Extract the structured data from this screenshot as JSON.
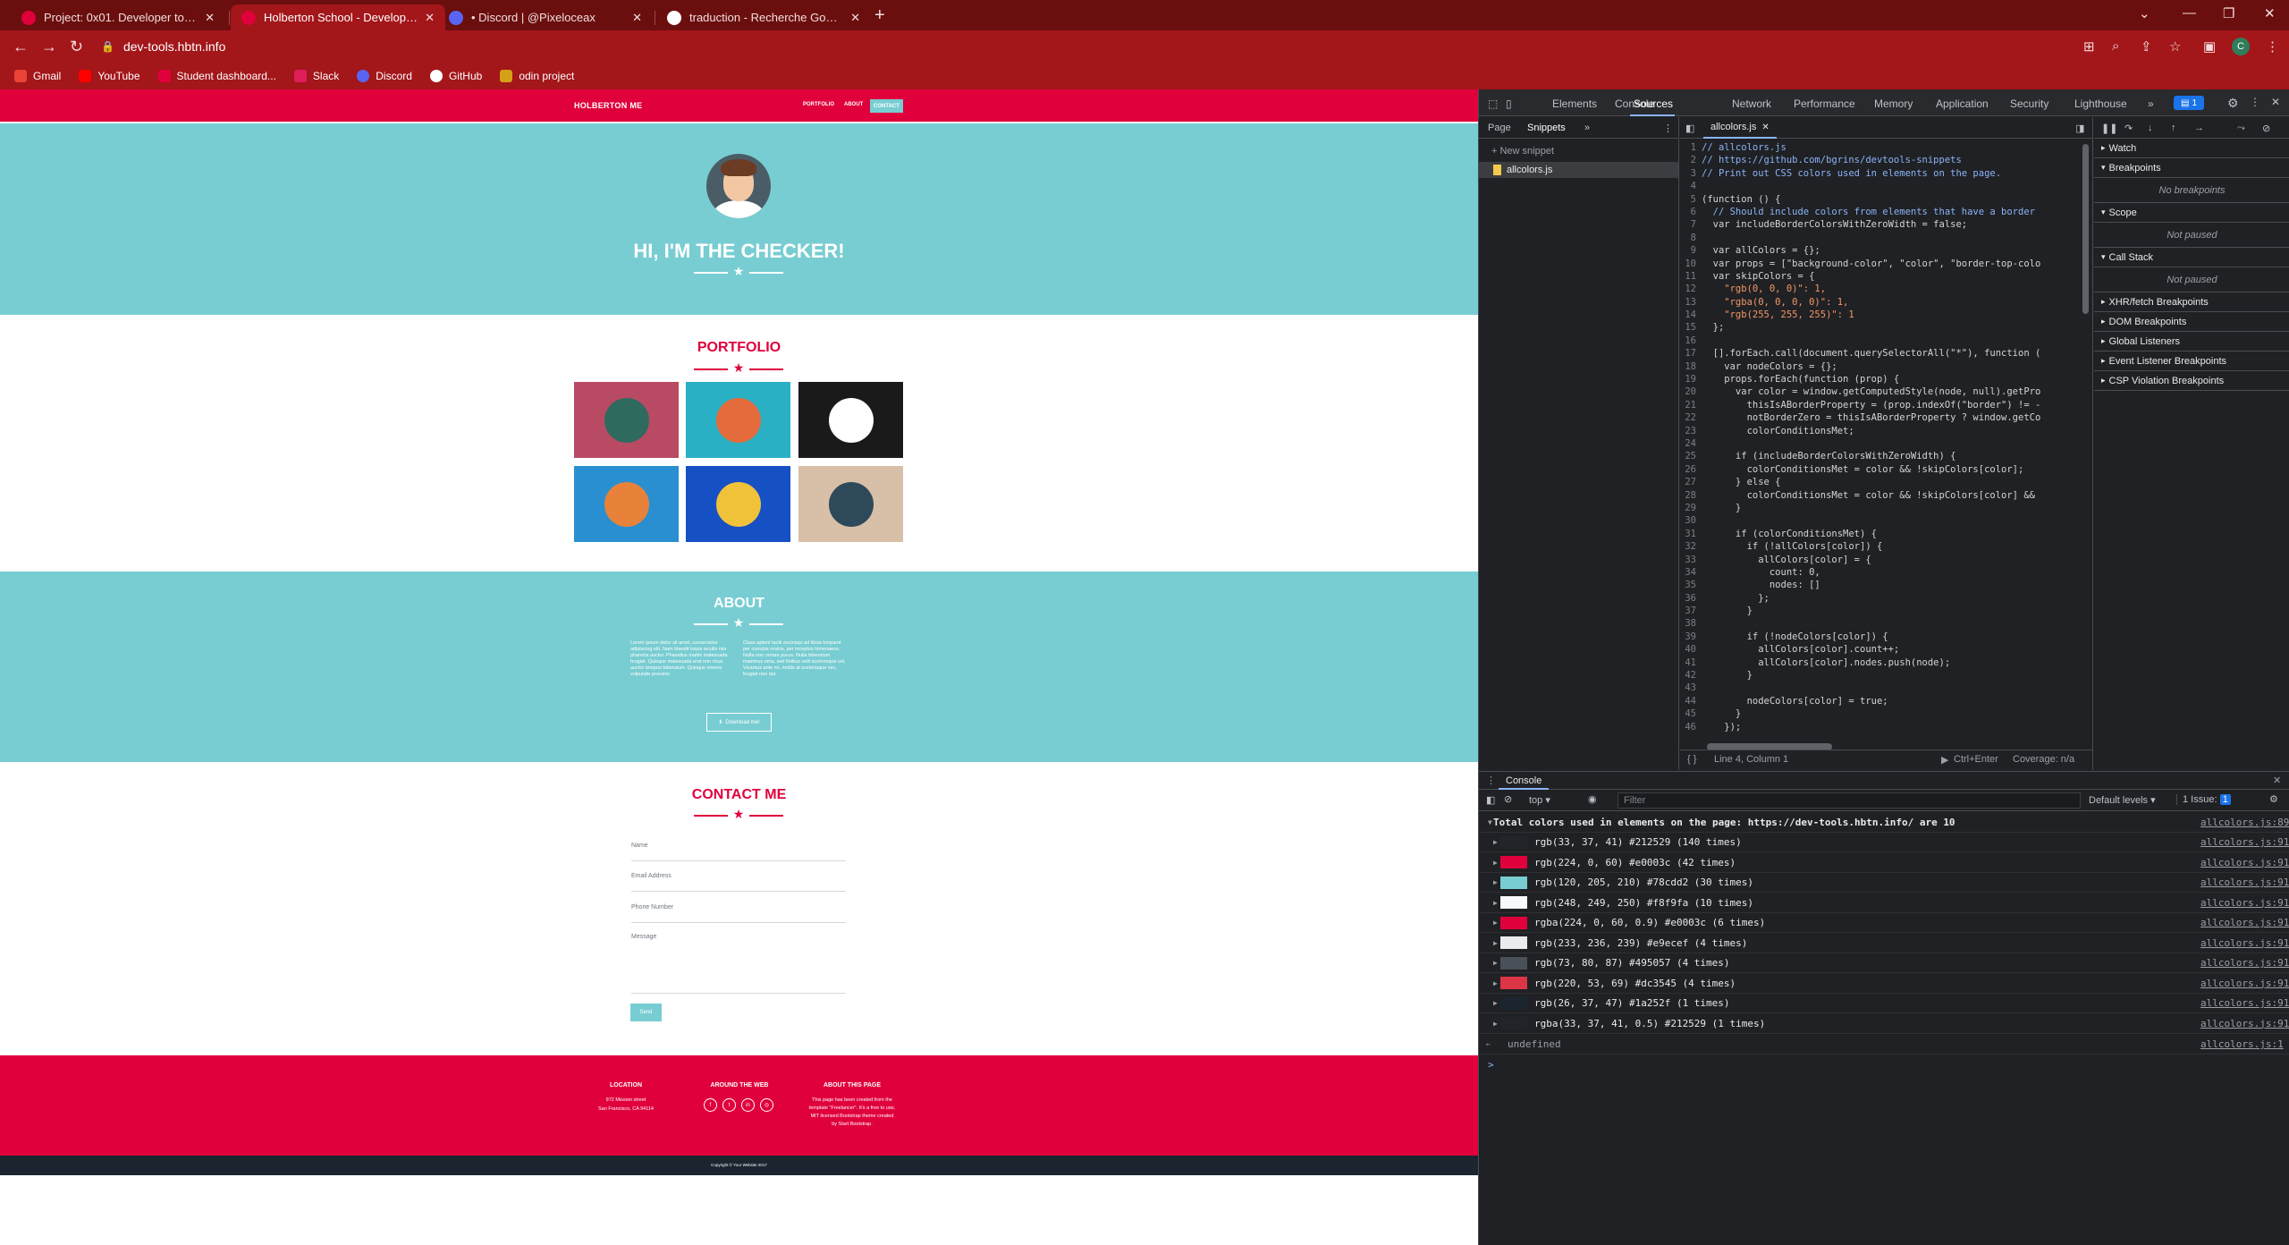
{
  "browser": {
    "tabs": [
      {
        "title": "Project: 0x01. Developer tools | H",
        "color": "#e0003c"
      },
      {
        "title": "Holberton School - Developer to",
        "color": "#e0003c"
      },
      {
        "title": "• Discord | @Pixeloceax",
        "color": "#5865f2"
      },
      {
        "title": "traduction - Recherche Google",
        "color": "#4285f4"
      }
    ],
    "url": "dev-tools.hbtn.info",
    "profile_initial": "C",
    "bookmarks": [
      {
        "label": "Gmail",
        "color": "#ea4335"
      },
      {
        "label": "YouTube",
        "color": "#ff0000"
      },
      {
        "label": "Student dashboard...",
        "color": "#e0003c"
      },
      {
        "label": "Slack",
        "color": "#e01e5a"
      },
      {
        "label": "Discord",
        "color": "#5865f2"
      },
      {
        "label": "GitHub",
        "color": "#ffffff"
      },
      {
        "label": "odin project",
        "color": "#d4a017"
      }
    ]
  },
  "site": {
    "brand": "HOLBERTON ME",
    "nav": {
      "portfolio": "PORTFOLIO",
      "about": "ABOUT",
      "contact": "CONTACT"
    },
    "hero_title": "HI, I'M THE CHECKER!",
    "portfolio_title": "PORTFOLIO",
    "portfolio_tiles": [
      {
        "bg": "#b94a63",
        "circle": "#2e6b5e",
        "icon": "cabin-icon"
      },
      {
        "bg": "#2ab0c4",
        "circle": "#e36a3a",
        "icon": "cake-icon"
      },
      {
        "bg": "#1a1a1a",
        "circle": "#ffffff",
        "icon": "circus-tent-icon"
      },
      {
        "bg": "#2a8fd0",
        "circle": "#e8823a",
        "icon": "game-controller-icon"
      },
      {
        "bg": "#1550c5",
        "circle": "#f0c23a",
        "icon": "safe-icon"
      },
      {
        "bg": "#d7bfa8",
        "circle": "#2e4a5a",
        "icon": "submarine-icon"
      }
    ],
    "about_title": "ABOUT",
    "about_left": "Lorem ipsum dolor sit amet, consectetur adipiscing elit. Nam blandit turpis iaculis nisi pharetra auctor. Phasellus mattis malesuada feugiat. Quisque malesuada erat non risus auctor tempus bibendum. Quisque viverra vulputate posuere.",
    "about_right": "Class aptent taciti sociosqu ad litora torquent per conubia nostra, per inceptos himenaeos. Nulla non ornare purus. Nulla bibendum maximus urna, sed finibus velit scelerisque vel. Vivamus ante mi, mollis at scelerisque nec, feugiat non dui.",
    "download_label": "Download me!",
    "contact_title": "CONTACT ME",
    "form": {
      "name": "Name",
      "email": "Email Address",
      "phone": "Phone Number",
      "message": "Message",
      "send": "Send"
    },
    "footer": {
      "location_h": "LOCATION",
      "location_t1": "972 Mission street",
      "location_t2": "San Francisco, CA 94114",
      "web_h": "AROUND THE WEB",
      "social": [
        "f",
        "t",
        "in",
        "◎"
      ],
      "about_h": "ABOUT THIS PAGE",
      "about_t1": "This page has been created from the",
      "about_t2": "template \"Freelancer\". It's a free to use,",
      "about_t3": "MIT licensed Bootstrap theme created",
      "about_t4": "by Start Bootstrap."
    },
    "copyright": "Copyright © Your Website 2017"
  },
  "devtools": {
    "tabs": [
      "Elements",
      "Console",
      "Sources",
      "Network",
      "Performance",
      "Memory",
      "Application",
      "Security",
      "Lighthouse"
    ],
    "more": "»",
    "issues": "1",
    "nav_tabs": {
      "page": "Page",
      "snippets": "Snippets"
    },
    "new_snippet": "+ New snippet",
    "snippet_file": "allcolors.js",
    "editor_file": "allcolors.js",
    "code": [
      "// allcolors.js",
      "// https://github.com/bgrins/devtools-snippets",
      "// Print out CSS colors used in elements on the page.",
      "",
      "(function () {",
      "  // Should include colors from elements that have a border",
      "  var includeBorderColorsWithZeroWidth = false;",
      "",
      "  var allColors = {};",
      "  var props = [\"background-color\", \"color\", \"border-top-colo",
      "  var skipColors = {",
      "    \"rgb(0, 0, 0)\": 1,",
      "    \"rgba(0, 0, 0, 0)\": 1,",
      "    \"rgb(255, 255, 255)\": 1",
      "  };",
      "",
      "  [].forEach.call(document.querySelectorAll(\"*\"), function (",
      "    var nodeColors = {};",
      "    props.forEach(function (prop) {",
      "      var color = window.getComputedStyle(node, null).getPro",
      "        thisIsABorderProperty = (prop.indexOf(\"border\") != -",
      "        notBorderZero = thisIsABorderProperty ? window.getCo",
      "        colorConditionsMet;",
      "",
      "      if (includeBorderColorsWithZeroWidth) {",
      "        colorConditionsMet = color && !skipColors[color];",
      "      } else {",
      "        colorConditionsMet = color && !skipColors[color] &&",
      "      }",
      "",
      "      if (colorConditionsMet) {",
      "        if (!allColors[color]) {",
      "          allColors[color] = {",
      "            count: 0,",
      "            nodes: []",
      "          };",
      "        }",
      "",
      "        if (!nodeColors[color]) {",
      "          allColors[color].count++;",
      "          allColors[color].nodes.push(node);",
      "        }",
      "",
      "        nodeColors[color] = true;",
      "      }",
      "    });"
    ],
    "status": {
      "position": "Line 4, Column 1",
      "run": "Ctrl+Enter",
      "coverage": "Coverage: n/a"
    },
    "debugger": [
      {
        "label": "Watch"
      },
      {
        "label": "Breakpoints",
        "empty": "No breakpoints"
      },
      {
        "label": "Scope",
        "empty": "Not paused"
      },
      {
        "label": "Call Stack",
        "empty": "Not paused"
      },
      {
        "label": "XHR/fetch Breakpoints"
      },
      {
        "label": "DOM Breakpoints"
      },
      {
        "label": "Global Listeners"
      },
      {
        "label": "Event Listener Breakpoints"
      },
      {
        "label": "CSP Violation Breakpoints"
      }
    ],
    "console": {
      "tab": "Console",
      "context": "top",
      "filter_placeholder": "Filter",
      "levels": "Default levels",
      "issues": "1 Issue:",
      "issues_count": "1",
      "summary": "Total colors used in elements on the page: https://dev-tools.hbtn.info/ are 10",
      "summary_src": "allcolors.js:89",
      "rows": [
        {
          "text": "rgb(33, 37, 41) #212529 (140 times)",
          "color": "#212529",
          "src": "allcolors.js:91"
        },
        {
          "text": "rgb(224, 0, 60) #e0003c (42 times)",
          "color": "#e0003c",
          "src": "allcolors.js:91"
        },
        {
          "text": "rgb(120, 205, 210) #78cdd2 (30 times)",
          "color": "#78cdd2",
          "src": "allcolors.js:91"
        },
        {
          "text": "rgb(248, 249, 250) #f8f9fa (10 times)",
          "color": "#f8f9fa",
          "src": "allcolors.js:91"
        },
        {
          "text": "rgba(224, 0, 60, 0.9) #e0003c (6 times)",
          "color": "#e0003c",
          "src": "allcolors.js:91"
        },
        {
          "text": "rgb(233, 236, 239) #e9ecef (4 times)",
          "color": "#e9ecef",
          "src": "allcolors.js:91"
        },
        {
          "text": "rgb(73, 80, 87) #495057 (4 times)",
          "color": "#495057",
          "src": "allcolors.js:91"
        },
        {
          "text": "rgb(220, 53, 69) #dc3545 (4 times)",
          "color": "#dc3545",
          "src": "allcolors.js:91"
        },
        {
          "text": "rgb(26, 37, 47) #1a252f (1 times)",
          "color": "#1a252f",
          "src": "allcolors.js:91"
        },
        {
          "text": "rgba(33, 37, 41, 0.5) #212529 (1 times)",
          "color": "#212529",
          "src": "allcolors.js:91"
        }
      ],
      "return_value": "undefined",
      "return_src": "allcolors.js:1",
      "prompt": ">"
    }
  }
}
